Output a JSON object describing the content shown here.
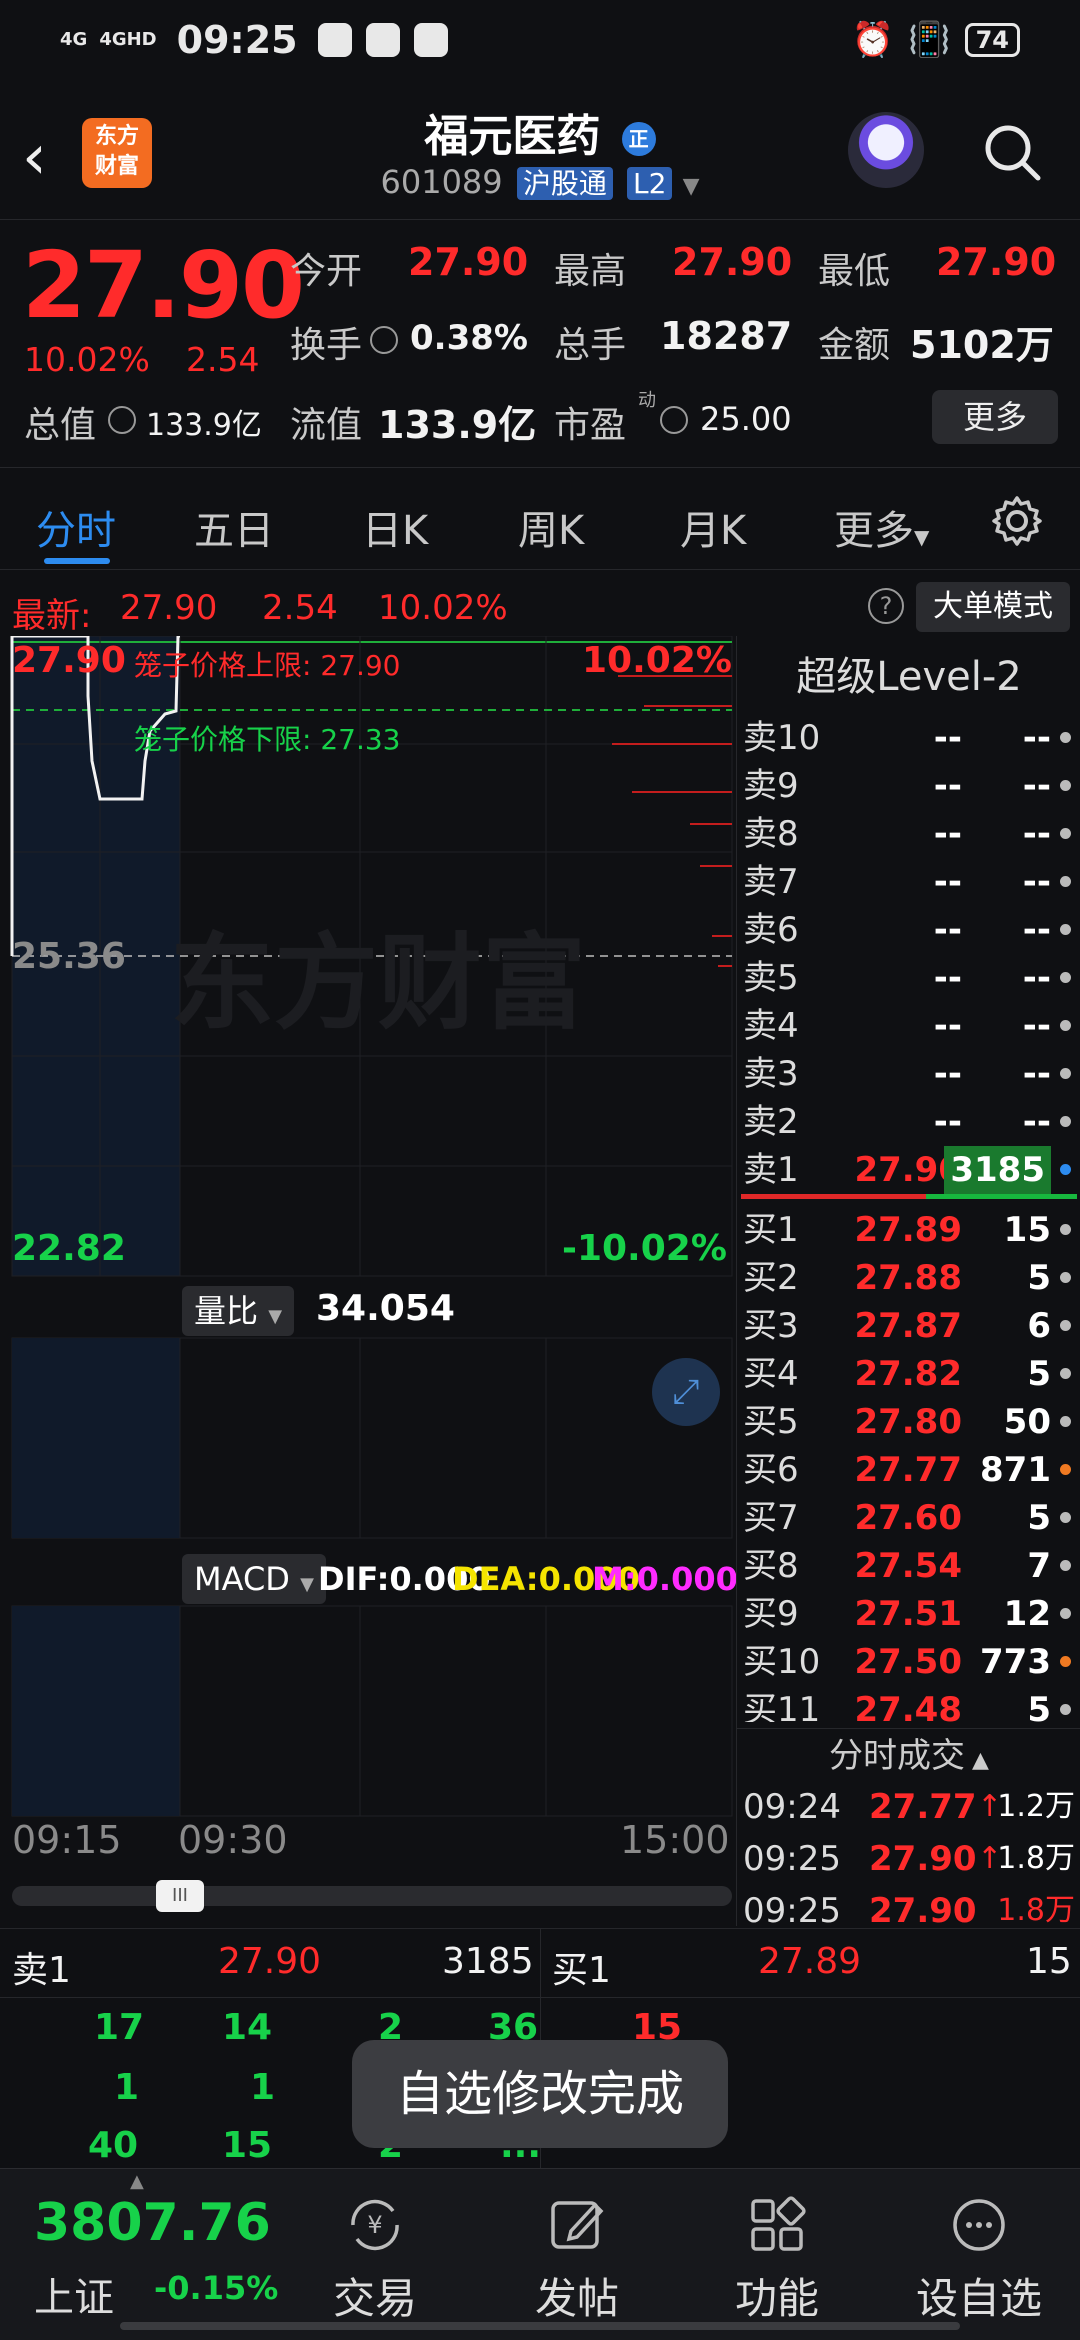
{
  "status_bar": {
    "net1": "4G",
    "net2": "4GHD",
    "time": "09:25",
    "battery": "74"
  },
  "header": {
    "back": "‹",
    "logo_line1": "东方",
    "logo_line2": "财富",
    "stock_name": "福元医药",
    "badge": "正",
    "code": "601089",
    "market_tag": "沪股通",
    "level_tag": "L2"
  },
  "quote": {
    "price": "27.90",
    "pct": "10.02%",
    "change": "2.54",
    "open_label": "今开",
    "open": "27.90",
    "high_label": "最高",
    "high": "27.90",
    "low_label": "最低",
    "low": "27.90",
    "turnover_label": "换手",
    "turnover": "0.38%",
    "volume_label": "总手",
    "volume": "18287",
    "amount_label": "金额",
    "amount": "5102万",
    "mcap_label": "总值",
    "mcap": "133.9亿",
    "float_label": "流值",
    "float": "133.9亿",
    "pe_label": "市盈",
    "pe_sup": "动",
    "pe": "25.00",
    "more": "更多"
  },
  "tabs": [
    "分时",
    "五日",
    "日K",
    "周K",
    "月K",
    "更多"
  ],
  "latest": {
    "label": "最新:",
    "price": "27.90",
    "change": "2.54",
    "pct": "10.02%",
    "mode_button": "大单模式",
    "help": "?"
  },
  "chart": {
    "upper_price": "27.90",
    "upper_limit": "笼子价格上限: 27.90",
    "lower_limit": "笼子价格下限: 27.33",
    "upper_pct": "10.02%",
    "mid_price": "25.36",
    "watermark": "东方财富",
    "low_price": "22.82",
    "low_pct": "-10.02%",
    "vol_ratio_label": "量比",
    "vol_ratio": "34.054",
    "macd_label": "MACD",
    "dif": "DIF:0.000",
    "dea": "DEA:0.000",
    "m": "M:0.000",
    "time_start": "09:15",
    "time_mid": "09:30",
    "time_end": "15:00",
    "slider_grip": "III"
  },
  "order_book": {
    "title": "超级Level-2",
    "asks": [
      {
        "label": "卖10",
        "price": "--",
        "qty": "--"
      },
      {
        "label": "卖9",
        "price": "--",
        "qty": "--"
      },
      {
        "label": "卖8",
        "price": "--",
        "qty": "--"
      },
      {
        "label": "卖7",
        "price": "--",
        "qty": "--"
      },
      {
        "label": "卖6",
        "price": "--",
        "qty": "--"
      },
      {
        "label": "卖5",
        "price": "--",
        "qty": "--"
      },
      {
        "label": "卖4",
        "price": "--",
        "qty": "--"
      },
      {
        "label": "卖3",
        "price": "--",
        "qty": "--"
      },
      {
        "label": "卖2",
        "price": "--",
        "qty": "--"
      },
      {
        "label": "卖1",
        "price": "27.90",
        "qty": "3185"
      }
    ],
    "bids": [
      {
        "label": "买1",
        "price": "27.89",
        "qty": "15"
      },
      {
        "label": "买2",
        "price": "27.88",
        "qty": "5"
      },
      {
        "label": "买3",
        "price": "27.87",
        "qty": "6"
      },
      {
        "label": "买4",
        "price": "27.82",
        "qty": "5"
      },
      {
        "label": "买5",
        "price": "27.80",
        "qty": "50"
      },
      {
        "label": "买6",
        "price": "27.77",
        "qty": "871"
      },
      {
        "label": "买7",
        "price": "27.60",
        "qty": "5"
      },
      {
        "label": "买8",
        "price": "27.54",
        "qty": "7"
      },
      {
        "label": "买9",
        "price": "27.51",
        "qty": "12"
      },
      {
        "label": "买10",
        "price": "27.50",
        "qty": "773"
      },
      {
        "label": "买11",
        "price": "27.48",
        "qty": "5"
      }
    ],
    "ticks_title": "分时成交",
    "ticks": [
      {
        "time": "09:24",
        "price": "27.77",
        "arrow": "↑",
        "vol": "1.2万"
      },
      {
        "time": "09:25",
        "price": "27.90",
        "arrow": "↑",
        "vol": "1.8万"
      },
      {
        "time": "09:25",
        "price": "27.90",
        "arrow": "",
        "vol": "1.8万"
      }
    ]
  },
  "queue": {
    "sell_label": "卖1",
    "sell_price": "27.90",
    "sell_qty": "3185",
    "buy_label": "买1",
    "buy_price": "27.89",
    "buy_qty": "15",
    "row1": [
      "17",
      "14",
      "2",
      "36",
      "15"
    ],
    "row2": [
      "1",
      "1"
    ],
    "row3": [
      "40",
      "15",
      "2",
      "..."
    ]
  },
  "toast": "自选修改完成",
  "bottom_nav": {
    "index_value": "3807.76",
    "index_name": "上证",
    "index_pct": "-0.15%",
    "items": [
      "交易",
      "发帖",
      "功能",
      "设自选"
    ]
  }
}
